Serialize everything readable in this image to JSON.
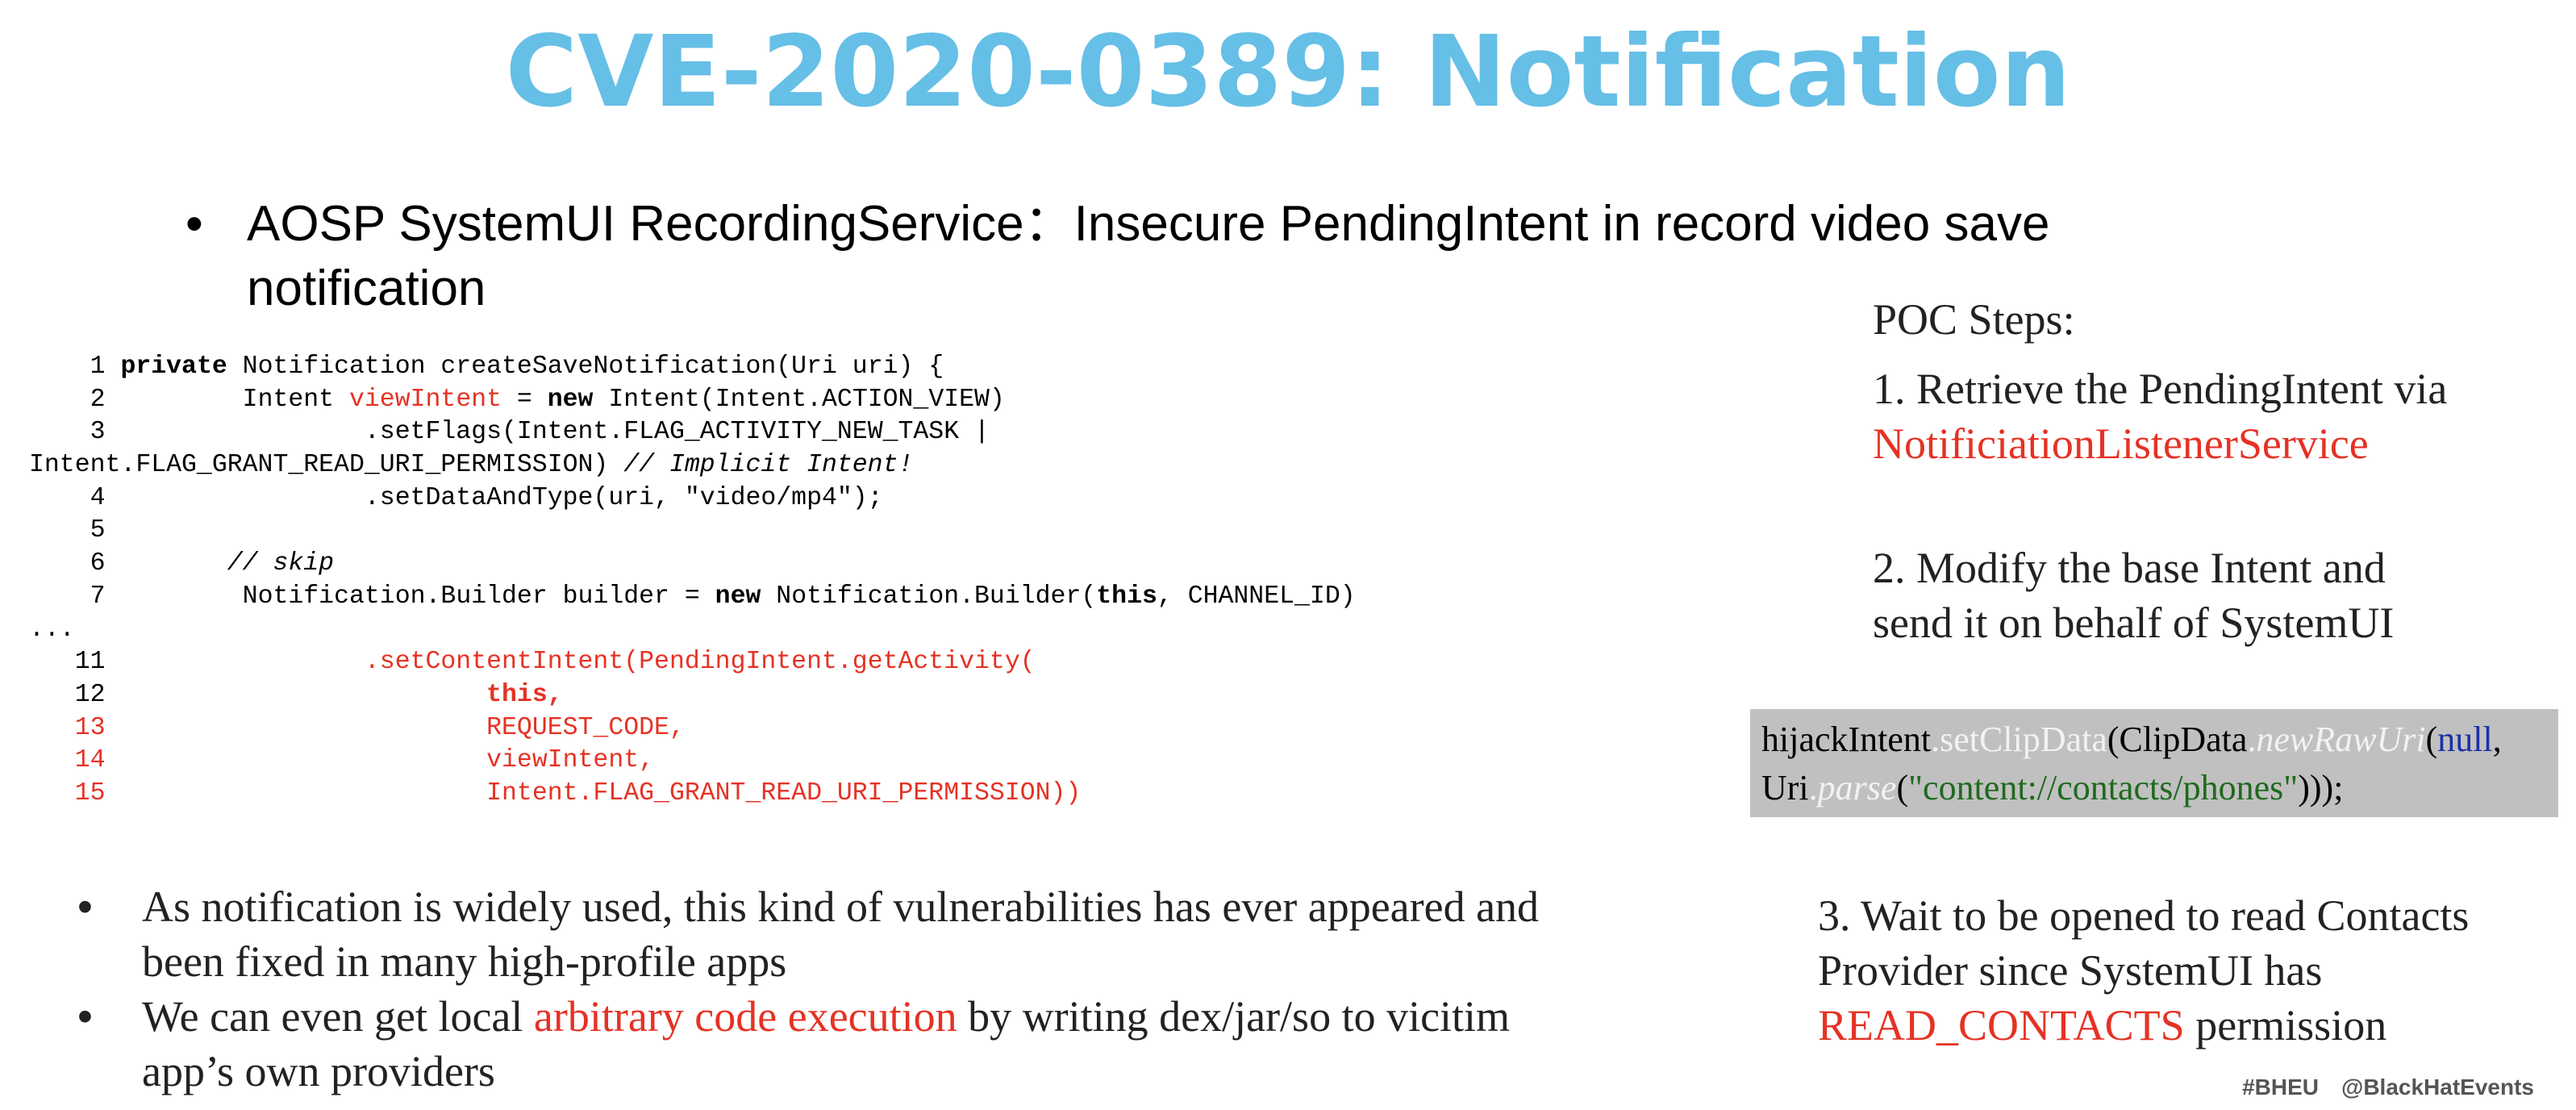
{
  "title": "CVE-2020-0389: Notification",
  "top_bullet": {
    "marker": "•",
    "text_line1": "AOSP SystemUI RecordingService：Insecure PendingIntent in record video save",
    "text_line2": "notification"
  },
  "code": {
    "l1_num": "1",
    "l1_kw": "private",
    "l1_rest": " Notification createSaveNotification(Uri uri) {",
    "l2_num": "2",
    "l2_a": "Intent ",
    "l2_var": "viewIntent",
    "l2_b": " = ",
    "l2_kw": "new",
    "l2_c": " Intent(Intent.ACTION_VIEW)",
    "l3_num": "3",
    "l3_text": ".setFlags(Intent.FLAG_ACTIVITY_NEW_TASK |",
    "l3_wrap_a": "Intent.FLAG_GRANT_READ_URI_PERMISSION) ",
    "l3_wrap_comment": "// Implicit Intent!",
    "l4_num": "4",
    "l4_text": ".setDataAndType(uri, \"video/mp4\");",
    "l5_num": "5",
    "l6_num": "6",
    "l6_comment": "// skip",
    "l7_num": "7",
    "l7_a": "Notification.Builder builder = ",
    "l7_kw": "new",
    "l7_b": " Notification.Builder(",
    "l7_kw2": "this",
    "l7_c": ", CHANNEL_ID)",
    "ellipsis": "...",
    "l11_num": "11",
    "l11_text": ".setContentIntent(PendingIntent.getActivity(",
    "l12_num": "12",
    "l12_text": "this,",
    "l13_num": "13",
    "l13_text": "REQUEST_CODE,",
    "l14_num": "14",
    "l14_text": "viewIntent,",
    "l15_num": "15",
    "l15_text": "Intent.FLAG_GRANT_READ_URI_PERMISSION))"
  },
  "poc": {
    "heading": "POC Steps:",
    "step1_a": "1. Retrieve the PendingIntent via",
    "step1_red": "NotificiationListenerService",
    "step2_a": "2. Modify the base Intent and",
    "step2_b": "send it on behalf of SystemUI",
    "step3_a": "3. Wait to be opened to read Contacts",
    "step3_b": "Provider since SystemUI has",
    "step3_red": "READ_CONTACTS",
    "step3_c": " permission"
  },
  "codebox": {
    "t1": "hijackIntent",
    "t2": ".",
    "t3": "setClipData",
    "t4": "(",
    "t5": "ClipData",
    "t6": ".",
    "t7": "newRawUri",
    "t8": "(",
    "t9": "null",
    "t10": ",",
    "t11": "Uri",
    "t12": ".",
    "t13": "parse",
    "t14": "(",
    "t15": "\"content://contacts/phones\"",
    "t16": ")));"
  },
  "bottom": {
    "marker": "•",
    "item1_l1": "As notification is widely used, this kind of vulnerabilities has ever appeared and",
    "item1_l2": "been fixed in  many high-profile apps",
    "item2_a": "We can even get local ",
    "item2_red": "arbitrary code execution",
    "item2_b": " by writing dex/jar/so to vicitim",
    "item2_l2": "app’s own providers"
  },
  "footer": {
    "tag1": "#BHEU",
    "tag2": "@BlackHatEvents"
  },
  "colors": {
    "title": "#66bfe6",
    "red": "#e53225",
    "codebox_bg": "#c0c0c0"
  }
}
